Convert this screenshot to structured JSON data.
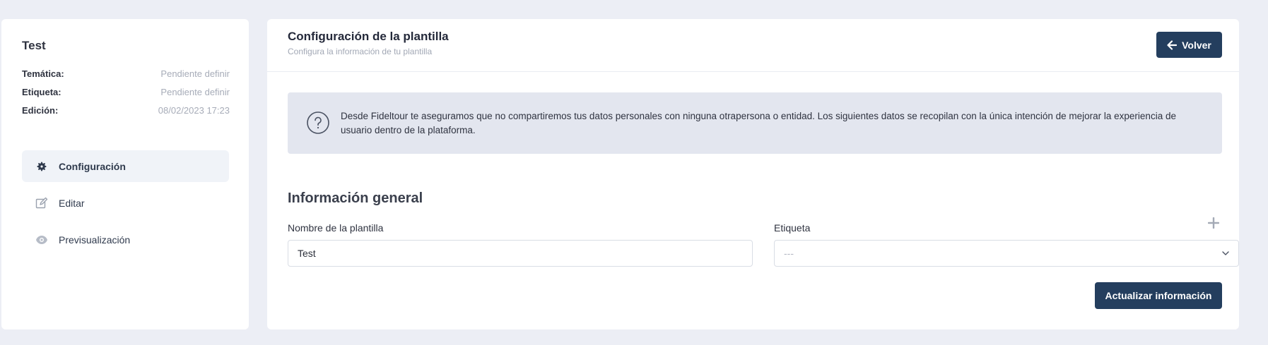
{
  "sidebar": {
    "title": "Test",
    "meta": [
      {
        "label": "Temática:",
        "value": "Pendiente definir"
      },
      {
        "label": "Etiqueta:",
        "value": "Pendiente definir"
      },
      {
        "label": "Edición:",
        "value": "08/02/2023 17:23"
      }
    ],
    "nav": [
      {
        "label": "Configuración",
        "icon": "gear-icon",
        "active": true
      },
      {
        "label": "Editar",
        "icon": "edit-icon",
        "active": false
      },
      {
        "label": "Previsualización",
        "icon": "eye-icon",
        "active": false
      }
    ]
  },
  "header": {
    "title": "Configuración de la plantilla",
    "subtitle": "Configura la información de tu plantilla",
    "back_label": "Volver"
  },
  "notice": {
    "icon": "question-circle-icon",
    "text": "Desde Fideltour te aseguramos que no compartiremos tus datos personales con ninguna otrapersona o entidad. Los siguientes datos se recopilan con la única intención de mejorar la experiencia de usuario dentro de la plataforma."
  },
  "form": {
    "section_title": "Información general",
    "name_label": "Nombre de la plantilla",
    "name_value": "Test",
    "tag_label": "Etiqueta",
    "tag_value": "---",
    "update_label": "Actualizar información"
  },
  "colors": {
    "primary": "#243e5e",
    "background": "#eceef5",
    "notice_bg": "#e3e6ef"
  }
}
